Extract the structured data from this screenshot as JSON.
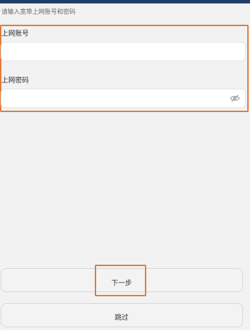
{
  "header": {
    "instruction": "请输入宽带上网账号和密码"
  },
  "form": {
    "account_label": "上网账号",
    "account_value": "",
    "password_label": "上网密码",
    "password_value": "",
    "password_toggle_icon": "eye-hidden-icon"
  },
  "actions": {
    "next_label": "下一步",
    "skip_label": "跳过"
  },
  "colors": {
    "accent_highlight": "#e07a34",
    "topbar": "#1f3f67",
    "background": "#f2f2f2"
  }
}
